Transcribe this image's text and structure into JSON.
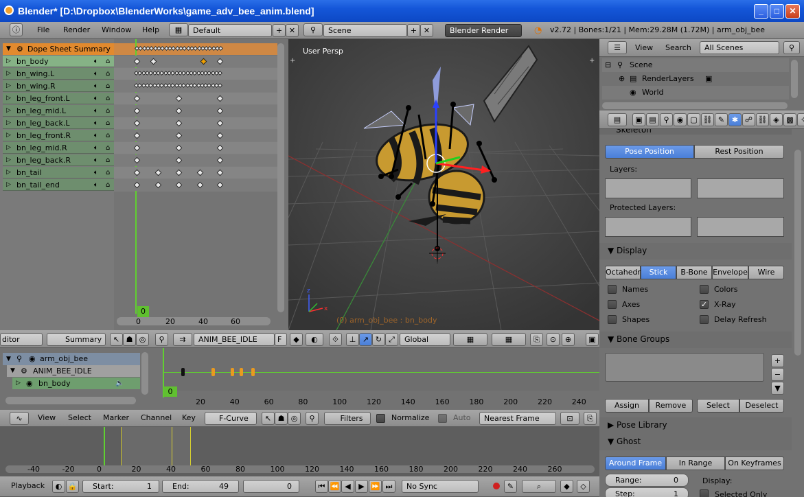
{
  "window": {
    "title": "Blender* [D:\\Dropbox\\BlenderWorks\\game_adv_bee_anim.blend]"
  },
  "topbar": {
    "menus": [
      "File",
      "Render",
      "Window",
      "Help"
    ],
    "layout": "Default",
    "scene": "Scene",
    "engine": "Blender Render",
    "stats": "v2.72 | Bones:1/21 | Mem:29.28M (1.72M) | arm_obj_bee"
  },
  "dopesheet": {
    "summary": "Dope Sheet Summary",
    "channels": [
      "bn_body",
      "bn_wing.L",
      "bn_wing.R",
      "bn_leg_front.L",
      "bn_leg_mid.L",
      "bn_leg_back.L",
      "bn_leg_front.R",
      "bn_leg_mid.R",
      "bn_leg_back.R",
      "bn_tail",
      "bn_tail_end"
    ],
    "current_frame": "0",
    "ruler": [
      "0",
      "20",
      "40",
      "60"
    ],
    "header": {
      "mode": "ditor",
      "summary_btn": "Summary",
      "action": "ANIM_BEE_IDLE",
      "f": "F"
    }
  },
  "viewport": {
    "label": "User Persp",
    "footer": {
      "orientation": "Global"
    }
  },
  "outliner": {
    "view": "View",
    "search": "Search",
    "filter": "All Scenes",
    "items": [
      "Scene",
      "RenderLayers",
      "World"
    ]
  },
  "properties": {
    "skeleton": "Skeleton",
    "pose_position": "Pose Position",
    "rest_position": "Rest Position",
    "layers": "Layers:",
    "protected_layers": "Protected Layers:",
    "display": "Display",
    "display_types": [
      "Octahedr",
      "Stick",
      "B-Bone",
      "Envelope",
      "Wire"
    ],
    "checks": [
      {
        "label": "Names",
        "checked": false
      },
      {
        "label": "Colors",
        "checked": false
      },
      {
        "label": "Axes",
        "checked": false
      },
      {
        "label": "X-Ray",
        "checked": true
      },
      {
        "label": "Shapes",
        "checked": false
      },
      {
        "label": "Delay Refresh",
        "checked": false
      }
    ],
    "bone_groups": "Bone Groups",
    "bg_buttons": [
      "Assign",
      "Remove",
      "Select",
      "Deselect"
    ],
    "pose_library": "Pose Library",
    "ghost": "Ghost",
    "ghost_types": [
      "Around Frame",
      "In Range",
      "On Keyframes"
    ],
    "range_label": "Range:",
    "range_value": "0",
    "step_label": "Step:",
    "step_value": "1",
    "display_label": "Display:",
    "selected_only": "Selected Only"
  },
  "nla": {
    "items": [
      "arm_obj_bee",
      "ANIM_BEE_IDLE",
      "bn_body"
    ],
    "current_frame": "0",
    "ruler": [
      "20",
      "40",
      "60",
      "80",
      "100",
      "120",
      "140",
      "160",
      "180",
      "200",
      "220",
      "240"
    ]
  },
  "graph": {
    "menus": [
      "View",
      "Select",
      "Marker",
      "Channel",
      "Key"
    ],
    "mode": "F-Curve",
    "filters": "Filters",
    "normalize": "Normalize",
    "auto": "Auto",
    "snap": "Nearest Frame",
    "ruler": [
      "-40",
      "-20",
      "0",
      "20",
      "40",
      "60",
      "80",
      "100",
      "120",
      "140",
      "160",
      "180",
      "200",
      "220",
      "240",
      "260"
    ]
  },
  "timeline": {
    "playback": "Playback",
    "start_label": "Start:",
    "start": "1",
    "end_label": "End:",
    "end": "49",
    "current": "0",
    "sync": "No Sync"
  }
}
